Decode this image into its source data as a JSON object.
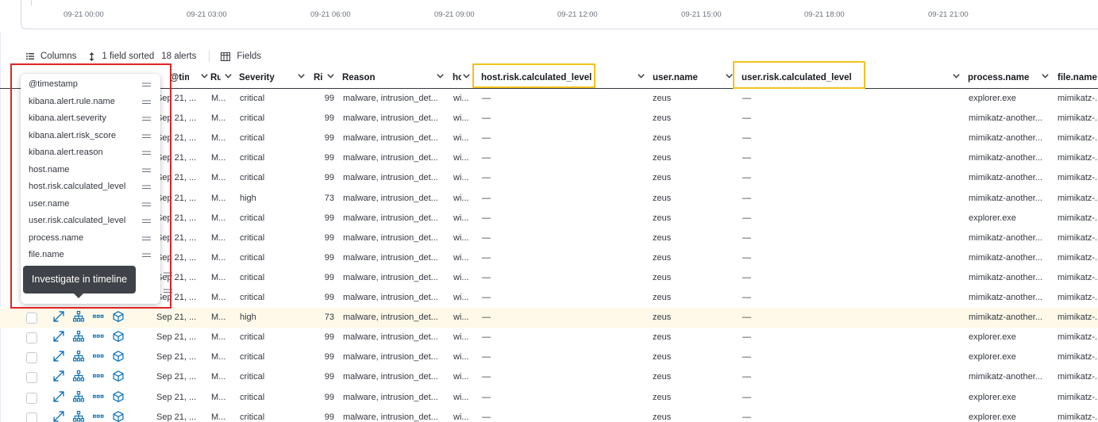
{
  "histogram": {
    "ticks": [
      "09-21 00:00",
      "09-21 03:00",
      "09-21 06:00",
      "09-21 09:00",
      "09-21 12:00",
      "09-21 15:00",
      "09-21 18:00",
      "09-21 21:00"
    ]
  },
  "toolbar": {
    "columns_label": "Columns",
    "sorted_label": "1 field sorted",
    "alerts_count": "18 alerts",
    "fields_label": "Fields"
  },
  "headers": {
    "timestamp": "@timestamp",
    "rule": "Rule",
    "severity": "Severity",
    "risk": "Risk score",
    "reason": "Reason",
    "host": "host.name",
    "host_risk": "host.risk.calculated_level",
    "user": "user.name",
    "user_risk": "user.risk.calculated_level",
    "process": "process.name",
    "file": "file.name"
  },
  "column_popover": {
    "items": [
      "@timestamp",
      "kibana.alert.rule.name",
      "kibana.alert.severity",
      "kibana.alert.risk_score",
      "kibana.alert.reason",
      "host.name",
      "host.risk.calculated_level",
      "user.name",
      "user.risk.calculated_level",
      "process.name",
      "file.name"
    ],
    "tooltip": "Investigate in timeline"
  },
  "rows": [
    {
      "ts": "Sep 21, ...",
      "rule": "M...",
      "sev": "critical",
      "risk": "99",
      "reason": "malware, intrusion_det...",
      "host": "wi...",
      "hrisk": "—",
      "user": "zeus",
      "urisk": "—",
      "proc": "explorer.exe",
      "file": "mimikatz-..."
    },
    {
      "ts": "Sep 21, ...",
      "rule": "M...",
      "sev": "critical",
      "risk": "99",
      "reason": "malware, intrusion_det...",
      "host": "wi...",
      "hrisk": "—",
      "user": "zeus",
      "urisk": "—",
      "proc": "mimikatz-another...",
      "file": "mimikatz-..."
    },
    {
      "ts": "Sep 21, ...",
      "rule": "M...",
      "sev": "critical",
      "risk": "99",
      "reason": "malware, intrusion_det...",
      "host": "wi...",
      "hrisk": "—",
      "user": "zeus",
      "urisk": "—",
      "proc": "mimikatz-another...",
      "file": "mimikatz-..."
    },
    {
      "ts": "Sep 21, ...",
      "rule": "M...",
      "sev": "critical",
      "risk": "99",
      "reason": "malware, intrusion_det...",
      "host": "wi...",
      "hrisk": "—",
      "user": "zeus",
      "urisk": "—",
      "proc": "mimikatz-another...",
      "file": "mimikatz-..."
    },
    {
      "ts": "Sep 21, ...",
      "rule": "M...",
      "sev": "critical",
      "risk": "99",
      "reason": "malware, intrusion_det...",
      "host": "wi...",
      "hrisk": "—",
      "user": "zeus",
      "urisk": "—",
      "proc": "mimikatz-another...",
      "file": "mimikatz-..."
    },
    {
      "ts": "Sep 21, ...",
      "rule": "M...",
      "sev": "high",
      "risk": "73",
      "reason": "malware, intrusion_det...",
      "host": "wi...",
      "hrisk": "—",
      "user": "zeus",
      "urisk": "—",
      "proc": "mimikatz-another...",
      "file": "mimikatz-..."
    },
    {
      "ts": "Sep 21, ...",
      "rule": "M...",
      "sev": "critical",
      "risk": "99",
      "reason": "malware, intrusion_det...",
      "host": "wi...",
      "hrisk": "—",
      "user": "zeus",
      "urisk": "—",
      "proc": "explorer.exe",
      "file": "mimikatz-..."
    },
    {
      "ts": "Sep 21, ...",
      "rule": "M...",
      "sev": "critical",
      "risk": "99",
      "reason": "malware, intrusion_det...",
      "host": "wi...",
      "hrisk": "—",
      "user": "zeus",
      "urisk": "—",
      "proc": "mimikatz-another...",
      "file": "mimikatz-..."
    },
    {
      "ts": "Sep 21, ...",
      "rule": "M...",
      "sev": "critical",
      "risk": "99",
      "reason": "malware, intrusion_det...",
      "host": "wi...",
      "hrisk": "—",
      "user": "zeus",
      "urisk": "—",
      "proc": "mimikatz-another...",
      "file": "mimikatz-..."
    },
    {
      "ts": "Sep 21, ...",
      "rule": "M...",
      "sev": "critical",
      "risk": "99",
      "reason": "malware, intrusion_det...",
      "host": "wi...",
      "hrisk": "—",
      "user": "zeus",
      "urisk": "—",
      "proc": "mimikatz-another...",
      "file": "mimikatz-..."
    },
    {
      "ts": "Sep 21, ...",
      "rule": "M...",
      "sev": "critical",
      "risk": "99",
      "reason": "malware, intrusion_det...",
      "host": "wi...",
      "hrisk": "—",
      "user": "zeus",
      "urisk": "—",
      "proc": "mimikatz-another...",
      "file": "mimikatz-..."
    },
    {
      "ts": "Sep 21, ...",
      "rule": "M...",
      "sev": "high",
      "risk": "73",
      "reason": "malware, intrusion_det...",
      "host": "wi...",
      "hrisk": "—",
      "user": "zeus",
      "urisk": "—",
      "proc": "mimikatz-another...",
      "file": "mimikatz-..."
    },
    {
      "ts": "Sep 21, ...",
      "rule": "M...",
      "sev": "critical",
      "risk": "99",
      "reason": "malware, intrusion_det...",
      "host": "wi...",
      "hrisk": "—",
      "user": "zeus",
      "urisk": "—",
      "proc": "explorer.exe",
      "file": "mimikatz-..."
    },
    {
      "ts": "Sep 21, ...",
      "rule": "M...",
      "sev": "critical",
      "risk": "99",
      "reason": "malware, intrusion_det...",
      "host": "wi...",
      "hrisk": "—",
      "user": "zeus",
      "urisk": "—",
      "proc": "explorer.exe",
      "file": "mimikatz-..."
    },
    {
      "ts": "Sep 21, ...",
      "rule": "M...",
      "sev": "critical",
      "risk": "99",
      "reason": "malware, intrusion_det...",
      "host": "wi...",
      "hrisk": "—",
      "user": "zeus",
      "urisk": "—",
      "proc": "mimikatz-another...",
      "file": "mimikatz-..."
    },
    {
      "ts": "Sep 21, ...",
      "rule": "M...",
      "sev": "critical",
      "risk": "99",
      "reason": "malware, intrusion_det...",
      "host": "wi...",
      "hrisk": "—",
      "user": "zeus",
      "urisk": "—",
      "proc": "explorer.exe",
      "file": "mimikatz-..."
    },
    {
      "ts": "Sep 21, ...",
      "rule": "M...",
      "sev": "critical",
      "risk": "99",
      "reason": "malware, intrusion_det...",
      "host": "wi...",
      "hrisk": "—",
      "user": "zeus",
      "urisk": "—",
      "proc": "explorer.exe",
      "file": "mimikatz-..."
    }
  ],
  "highlighted_row": 11,
  "colors": {
    "accent": "#006bb8",
    "highlight_box": "#f1c21b",
    "focus_box": "#e02424",
    "row_highlight": "#fef9e8",
    "tooltip_bg": "#404249"
  }
}
